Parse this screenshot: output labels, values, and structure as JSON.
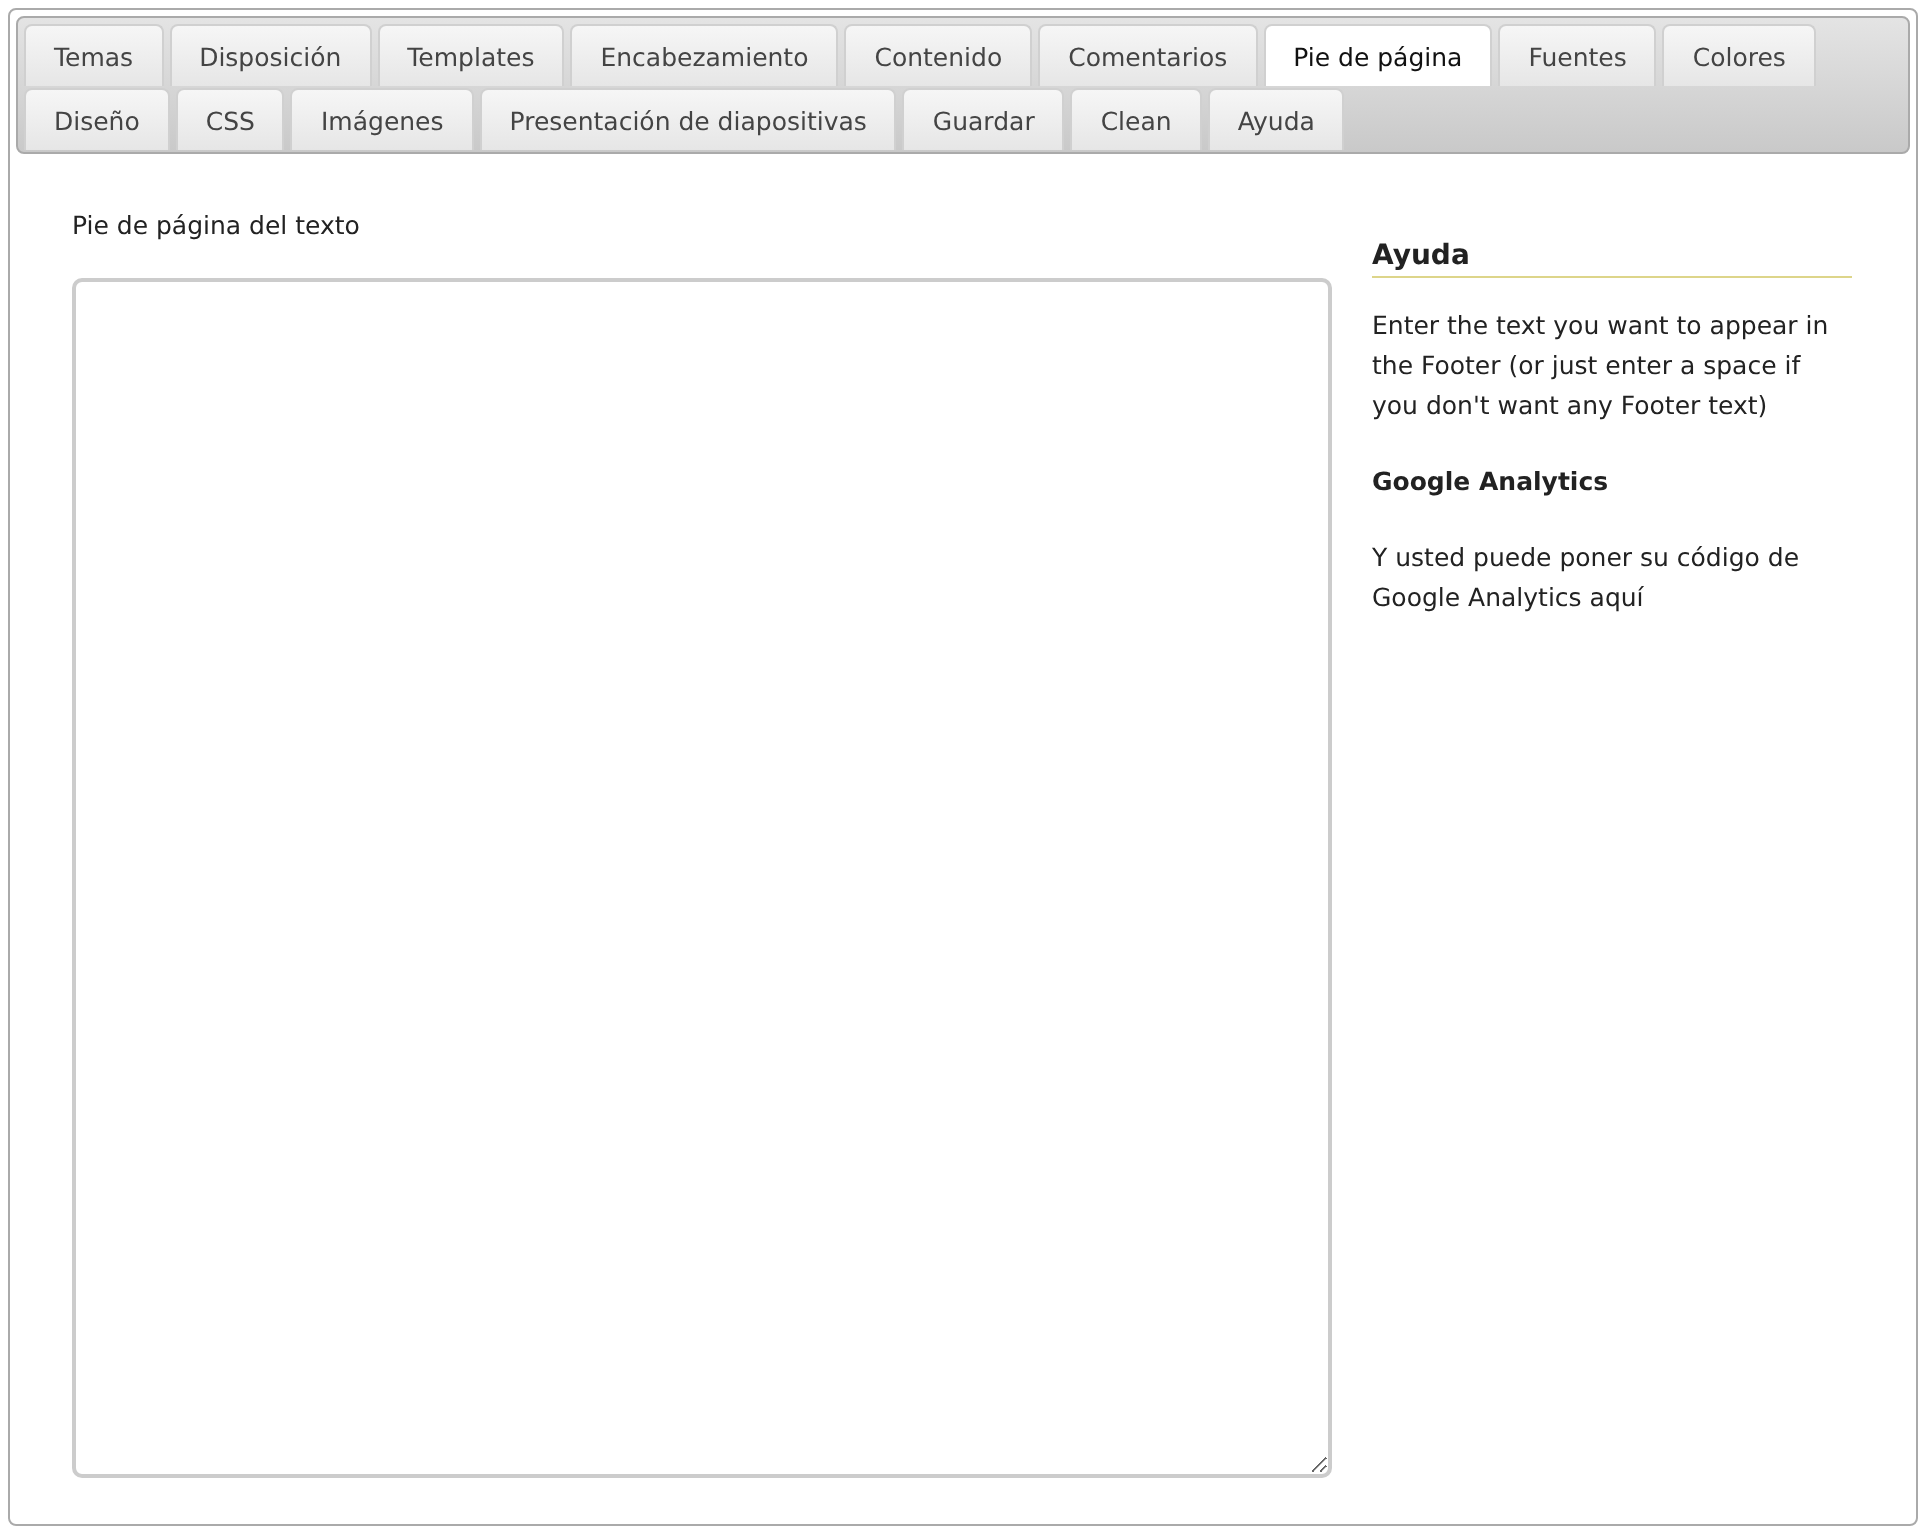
{
  "tab_rows": [
    [
      {
        "label": "Temas",
        "selected": false
      },
      {
        "label": "Disposición",
        "selected": false
      },
      {
        "label": "Templates",
        "selected": false
      },
      {
        "label": "Encabezamiento",
        "selected": false
      },
      {
        "label": "Contenido",
        "selected": false
      },
      {
        "label": "Comentarios",
        "selected": false
      },
      {
        "label": "Pie de página",
        "selected": true
      },
      {
        "label": "Fuentes",
        "selected": false
      },
      {
        "label": "Colores",
        "selected": false
      }
    ],
    [
      {
        "label": "Diseño",
        "selected": false
      },
      {
        "label": "CSS",
        "selected": false
      },
      {
        "label": "Imágenes",
        "selected": false
      },
      {
        "label": "Presentación de diapositivas",
        "selected": false
      },
      {
        "label": "Guardar",
        "selected": false
      },
      {
        "label": "Clean",
        "selected": false
      },
      {
        "label": "Ayuda",
        "selected": false
      }
    ]
  ],
  "footer_field": {
    "label": "Pie de página del texto"
  },
  "help": {
    "title": "Ayuda",
    "paragraphs": [
      {
        "kind": "text",
        "text": "Enter the text you want to appear in the Footer (or just enter a space if you don't want any Footer text)"
      },
      {
        "kind": "heading",
        "text": "Google Analytics"
      },
      {
        "kind": "text",
        "text": "Y usted puede poner su código de Google Analytics aquí"
      }
    ]
  }
}
